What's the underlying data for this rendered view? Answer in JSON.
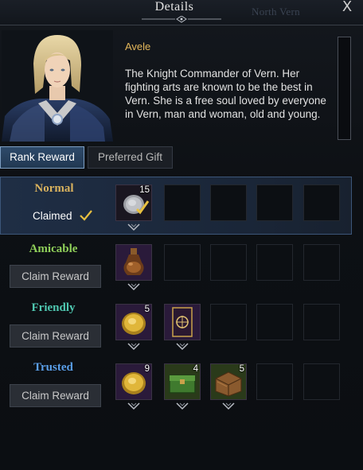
{
  "header": {
    "title": "Details",
    "region": "North Vern",
    "close_label": "X"
  },
  "character": {
    "name": "Avele",
    "description": "The Knight Commander of Vern. Her fighting arts are known to be the best in Vern. She is a free soul loved by everyone in Vern, man and woman, old and young."
  },
  "tabs": [
    {
      "label": "Rank Reward",
      "active": true
    },
    {
      "label": "Preferred Gift",
      "active": false
    }
  ],
  "ranks": [
    {
      "name": "Normal",
      "color": "#d9b25e",
      "status": "Claimed",
      "rewards": [
        {
          "icon": "coin-pouch-icon",
          "count": "15"
        }
      ]
    },
    {
      "name": "Amicable",
      "color": "#8fcf5a",
      "button": "Claim Reward",
      "rewards": [
        {
          "icon": "potion-flask-icon",
          "count": ""
        }
      ]
    },
    {
      "name": "Friendly",
      "color": "#4fc7b0",
      "button": "Claim Reward",
      "rewards": [
        {
          "icon": "gold-coin-icon",
          "count": "5"
        },
        {
          "icon": "card-icon",
          "count": ""
        }
      ]
    },
    {
      "name": "Trusted",
      "color": "#5a9ee8",
      "button": "Claim Reward",
      "rewards": [
        {
          "icon": "gold-coin-icon",
          "count": "9"
        },
        {
          "icon": "green-chest-icon",
          "count": "4"
        },
        {
          "icon": "wood-crate-icon",
          "count": "5"
        }
      ]
    }
  ],
  "colors": {
    "accent_gold": "#e3b65a",
    "tab_active": "#2e4a6a",
    "claimed_check": "#e8c040"
  }
}
